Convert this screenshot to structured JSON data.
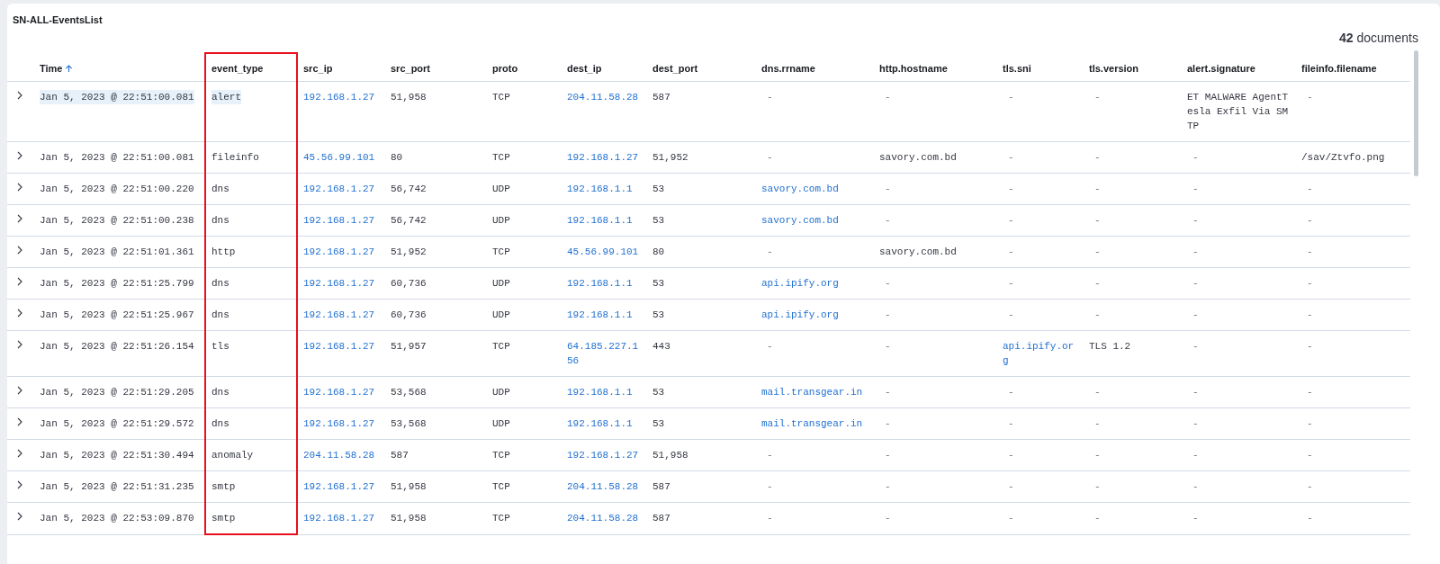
{
  "panel": {
    "title": "SN-ALL-EventsList",
    "hit_count": "42",
    "hit_label": "documents"
  },
  "table": {
    "columns": [
      {
        "label": "Time",
        "sorted": true,
        "highlighted": false
      },
      {
        "label": "event_type",
        "sorted": false,
        "highlighted": true
      },
      {
        "label": "src_ip",
        "sorted": false,
        "highlighted": false
      },
      {
        "label": "src_port",
        "sorted": false,
        "highlighted": false
      },
      {
        "label": "proto",
        "sorted": false,
        "highlighted": false
      },
      {
        "label": "dest_ip",
        "sorted": false,
        "highlighted": false
      },
      {
        "label": "dest_port",
        "sorted": false,
        "highlighted": false
      },
      {
        "label": "dns.rrname",
        "sorted": false,
        "highlighted": false
      },
      {
        "label": "http.hostname",
        "sorted": false,
        "highlighted": false
      },
      {
        "label": "tls.sni",
        "sorted": false,
        "highlighted": false
      },
      {
        "label": "tls.version",
        "sorted": false,
        "highlighted": false
      },
      {
        "label": "alert.signature",
        "sorted": false,
        "highlighted": false
      },
      {
        "label": "fileinfo.filename",
        "sorted": false,
        "highlighted": false
      }
    ],
    "rows": [
      {
        "cells": [
          {
            "text": "Jan 5, 2023 @ 22:51:00.081",
            "highlighted": true
          },
          {
            "text": "alert",
            "highlighted": true
          },
          {
            "text": "192.168.1.27",
            "kind": "link"
          },
          {
            "text": "51,958"
          },
          {
            "text": "TCP"
          },
          {
            "text": "204.11.58.28",
            "kind": "link"
          },
          {
            "text": "587"
          },
          {
            "text": "-",
            "kind": "empty"
          },
          {
            "text": "-",
            "kind": "empty"
          },
          {
            "text": "-",
            "kind": "empty"
          },
          {
            "text": "-",
            "kind": "empty"
          },
          {
            "text": "ET MALWARE AgentTesla Exfil Via SMTP"
          },
          {
            "text": "-",
            "kind": "empty"
          }
        ]
      },
      {
        "cells": [
          {
            "text": "Jan 5, 2023 @ 22:51:00.081"
          },
          {
            "text": "fileinfo"
          },
          {
            "text": "45.56.99.101",
            "kind": "link"
          },
          {
            "text": "80"
          },
          {
            "text": "TCP"
          },
          {
            "text": "192.168.1.27",
            "kind": "link"
          },
          {
            "text": "51,952"
          },
          {
            "text": "-",
            "kind": "empty"
          },
          {
            "text": "savory.com.bd"
          },
          {
            "text": "-",
            "kind": "empty"
          },
          {
            "text": "-",
            "kind": "empty"
          },
          {
            "text": "-",
            "kind": "empty"
          },
          {
            "text": "/sav/Ztvfo.png"
          }
        ]
      },
      {
        "cells": [
          {
            "text": "Jan 5, 2023 @ 22:51:00.220"
          },
          {
            "text": "dns"
          },
          {
            "text": "192.168.1.27",
            "kind": "link"
          },
          {
            "text": "56,742"
          },
          {
            "text": "UDP"
          },
          {
            "text": "192.168.1.1",
            "kind": "link"
          },
          {
            "text": "53"
          },
          {
            "text": "savory.com.bd",
            "kind": "link"
          },
          {
            "text": "-",
            "kind": "empty"
          },
          {
            "text": "-",
            "kind": "empty"
          },
          {
            "text": "-",
            "kind": "empty"
          },
          {
            "text": "-",
            "kind": "empty"
          },
          {
            "text": "-",
            "kind": "empty"
          }
        ]
      },
      {
        "cells": [
          {
            "text": "Jan 5, 2023 @ 22:51:00.238"
          },
          {
            "text": "dns"
          },
          {
            "text": "192.168.1.27",
            "kind": "link"
          },
          {
            "text": "56,742"
          },
          {
            "text": "UDP"
          },
          {
            "text": "192.168.1.1",
            "kind": "link"
          },
          {
            "text": "53"
          },
          {
            "text": "savory.com.bd",
            "kind": "link"
          },
          {
            "text": "-",
            "kind": "empty"
          },
          {
            "text": "-",
            "kind": "empty"
          },
          {
            "text": "-",
            "kind": "empty"
          },
          {
            "text": "-",
            "kind": "empty"
          },
          {
            "text": "-",
            "kind": "empty"
          }
        ]
      },
      {
        "cells": [
          {
            "text": "Jan 5, 2023 @ 22:51:01.361"
          },
          {
            "text": "http"
          },
          {
            "text": "192.168.1.27",
            "kind": "link"
          },
          {
            "text": "51,952"
          },
          {
            "text": "TCP"
          },
          {
            "text": "45.56.99.101",
            "kind": "link"
          },
          {
            "text": "80"
          },
          {
            "text": "-",
            "kind": "empty"
          },
          {
            "text": "savory.com.bd"
          },
          {
            "text": "-",
            "kind": "empty"
          },
          {
            "text": "-",
            "kind": "empty"
          },
          {
            "text": "-",
            "kind": "empty"
          },
          {
            "text": "-",
            "kind": "empty"
          }
        ]
      },
      {
        "cells": [
          {
            "text": "Jan 5, 2023 @ 22:51:25.799"
          },
          {
            "text": "dns"
          },
          {
            "text": "192.168.1.27",
            "kind": "link"
          },
          {
            "text": "60,736"
          },
          {
            "text": "UDP"
          },
          {
            "text": "192.168.1.1",
            "kind": "link"
          },
          {
            "text": "53"
          },
          {
            "text": "api.ipify.org",
            "kind": "link"
          },
          {
            "text": "-",
            "kind": "empty"
          },
          {
            "text": "-",
            "kind": "empty"
          },
          {
            "text": "-",
            "kind": "empty"
          },
          {
            "text": "-",
            "kind": "empty"
          },
          {
            "text": "-",
            "kind": "empty"
          }
        ]
      },
      {
        "cells": [
          {
            "text": "Jan 5, 2023 @ 22:51:25.967"
          },
          {
            "text": "dns"
          },
          {
            "text": "192.168.1.27",
            "kind": "link"
          },
          {
            "text": "60,736"
          },
          {
            "text": "UDP"
          },
          {
            "text": "192.168.1.1",
            "kind": "link"
          },
          {
            "text": "53"
          },
          {
            "text": "api.ipify.org",
            "kind": "link"
          },
          {
            "text": "-",
            "kind": "empty"
          },
          {
            "text": "-",
            "kind": "empty"
          },
          {
            "text": "-",
            "kind": "empty"
          },
          {
            "text": "-",
            "kind": "empty"
          },
          {
            "text": "-",
            "kind": "empty"
          }
        ]
      },
      {
        "cells": [
          {
            "text": "Jan 5, 2023 @ 22:51:26.154"
          },
          {
            "text": "tls"
          },
          {
            "text": "192.168.1.27",
            "kind": "link"
          },
          {
            "text": "51,957"
          },
          {
            "text": "TCP"
          },
          {
            "text": "64.185.227.156",
            "kind": "link"
          },
          {
            "text": "443"
          },
          {
            "text": "-",
            "kind": "empty"
          },
          {
            "text": "-",
            "kind": "empty"
          },
          {
            "text": "api.ipify.org",
            "kind": "link"
          },
          {
            "text": "TLS 1.2"
          },
          {
            "text": "-",
            "kind": "empty"
          },
          {
            "text": "-",
            "kind": "empty"
          }
        ]
      },
      {
        "cells": [
          {
            "text": "Jan 5, 2023 @ 22:51:29.205"
          },
          {
            "text": "dns"
          },
          {
            "text": "192.168.1.27",
            "kind": "link"
          },
          {
            "text": "53,568"
          },
          {
            "text": "UDP"
          },
          {
            "text": "192.168.1.1",
            "kind": "link"
          },
          {
            "text": "53"
          },
          {
            "text": "mail.transgear.in",
            "kind": "link"
          },
          {
            "text": "-",
            "kind": "empty"
          },
          {
            "text": "-",
            "kind": "empty"
          },
          {
            "text": "-",
            "kind": "empty"
          },
          {
            "text": "-",
            "kind": "empty"
          },
          {
            "text": "-",
            "kind": "empty"
          }
        ]
      },
      {
        "cells": [
          {
            "text": "Jan 5, 2023 @ 22:51:29.572"
          },
          {
            "text": "dns"
          },
          {
            "text": "192.168.1.27",
            "kind": "link"
          },
          {
            "text": "53,568"
          },
          {
            "text": "UDP"
          },
          {
            "text": "192.168.1.1",
            "kind": "link"
          },
          {
            "text": "53"
          },
          {
            "text": "mail.transgear.in",
            "kind": "link"
          },
          {
            "text": "-",
            "kind": "empty"
          },
          {
            "text": "-",
            "kind": "empty"
          },
          {
            "text": "-",
            "kind": "empty"
          },
          {
            "text": "-",
            "kind": "empty"
          },
          {
            "text": "-",
            "kind": "empty"
          }
        ]
      },
      {
        "cells": [
          {
            "text": "Jan 5, 2023 @ 22:51:30.494"
          },
          {
            "text": "anomaly"
          },
          {
            "text": "204.11.58.28",
            "kind": "link"
          },
          {
            "text": "587"
          },
          {
            "text": "TCP"
          },
          {
            "text": "192.168.1.27",
            "kind": "link"
          },
          {
            "text": "51,958"
          },
          {
            "text": "-",
            "kind": "empty"
          },
          {
            "text": "-",
            "kind": "empty"
          },
          {
            "text": "-",
            "kind": "empty"
          },
          {
            "text": "-",
            "kind": "empty"
          },
          {
            "text": "-",
            "kind": "empty"
          },
          {
            "text": "-",
            "kind": "empty"
          }
        ]
      },
      {
        "cells": [
          {
            "text": "Jan 5, 2023 @ 22:51:31.235"
          },
          {
            "text": "smtp"
          },
          {
            "text": "192.168.1.27",
            "kind": "link"
          },
          {
            "text": "51,958"
          },
          {
            "text": "TCP"
          },
          {
            "text": "204.11.58.28",
            "kind": "link"
          },
          {
            "text": "587"
          },
          {
            "text": "-",
            "kind": "empty"
          },
          {
            "text": "-",
            "kind": "empty"
          },
          {
            "text": "-",
            "kind": "empty"
          },
          {
            "text": "-",
            "kind": "empty"
          },
          {
            "text": "-",
            "kind": "empty"
          },
          {
            "text": "-",
            "kind": "empty"
          }
        ]
      },
      {
        "cells": [
          {
            "text": "Jan 5, 2023 @ 22:53:09.870"
          },
          {
            "text": "smtp"
          },
          {
            "text": "192.168.1.27",
            "kind": "link"
          },
          {
            "text": "51,958"
          },
          {
            "text": "TCP"
          },
          {
            "text": "204.11.58.28",
            "kind": "link"
          },
          {
            "text": "587"
          },
          {
            "text": "-",
            "kind": "empty"
          },
          {
            "text": "-",
            "kind": "empty"
          },
          {
            "text": "-",
            "kind": "empty"
          },
          {
            "text": "-",
            "kind": "empty"
          },
          {
            "text": "-",
            "kind": "empty"
          },
          {
            "text": "-",
            "kind": "empty"
          }
        ]
      }
    ]
  }
}
